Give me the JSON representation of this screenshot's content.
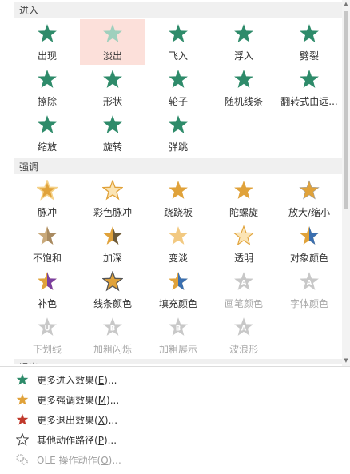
{
  "sections": {
    "entrance": "进入",
    "emphasis": "强调",
    "exit": "退出"
  },
  "entrance": [
    {
      "label": "出现",
      "icon": "appear-star-icon"
    },
    {
      "label": "淡出",
      "icon": "fade-star-icon"
    },
    {
      "label": "飞入",
      "icon": "fly-in-star-icon"
    },
    {
      "label": "浮入",
      "icon": "float-in-star-icon"
    },
    {
      "label": "劈裂",
      "icon": "split-star-icon"
    },
    {
      "label": "擦除",
      "icon": "wipe-star-icon"
    },
    {
      "label": "形状",
      "icon": "shape-star-icon"
    },
    {
      "label": "轮子",
      "icon": "wheel-star-icon"
    },
    {
      "label": "随机线条",
      "icon": "random-bars-star-icon"
    },
    {
      "label": "翻转式由远...",
      "icon": "grow-turn-star-icon"
    },
    {
      "label": "缩放",
      "icon": "zoom-star-icon"
    },
    {
      "label": "旋转",
      "icon": "swivel-star-icon"
    },
    {
      "label": "弹跳",
      "icon": "bounce-star-icon"
    }
  ],
  "emphasis": [
    {
      "label": "脉冲",
      "icon": "pulse-star-icon"
    },
    {
      "label": "彩色脉冲",
      "icon": "color-pulse-star-icon"
    },
    {
      "label": "跷跷板",
      "icon": "teeter-star-icon"
    },
    {
      "label": "陀螺旋",
      "icon": "spin-star-icon"
    },
    {
      "label": "放大/缩小",
      "icon": "grow-shrink-star-icon"
    },
    {
      "label": "不饱和",
      "icon": "desaturate-star-icon"
    },
    {
      "label": "加深",
      "icon": "darken-star-icon"
    },
    {
      "label": "变淡",
      "icon": "lighten-star-icon"
    },
    {
      "label": "透明",
      "icon": "transparency-star-icon"
    },
    {
      "label": "对象颜色",
      "icon": "object-color-star-icon"
    },
    {
      "label": "补色",
      "icon": "complementary-color-star-icon"
    },
    {
      "label": "线条颜色",
      "icon": "line-color-star-icon"
    },
    {
      "label": "填充颜色",
      "icon": "fill-color-star-icon"
    },
    {
      "label": "画笔颜色",
      "icon": "brush-color-star-icon",
      "disabled": true
    },
    {
      "label": "字体颜色",
      "icon": "font-color-star-icon",
      "disabled": true
    },
    {
      "label": "下划线",
      "icon": "underline-star-icon",
      "disabled": true
    },
    {
      "label": "加粗闪烁",
      "icon": "bold-flash-star-icon",
      "disabled": true
    },
    {
      "label": "加粗展示",
      "icon": "bold-reveal-star-icon",
      "disabled": true
    },
    {
      "label": "波浪形",
      "icon": "wave-star-icon",
      "disabled": true
    }
  ],
  "menu": [
    {
      "prefix": "更多进入效果(",
      "key": "E",
      "suffix": ")...",
      "icon": "green-star-icon"
    },
    {
      "prefix": "更多强调效果(",
      "key": "M",
      "suffix": ")...",
      "icon": "gold-star-icon"
    },
    {
      "prefix": "更多退出效果(",
      "key": "X",
      "suffix": ")...",
      "icon": "red-star-icon"
    },
    {
      "prefix": "其他动作路径(",
      "key": "P",
      "suffix": ")...",
      "icon": "outline-star-icon"
    },
    {
      "prefix": "OLE 操作动作(",
      "key": "O",
      "suffix": ")...",
      "icon": "gears-icon",
      "disabled": true
    }
  ],
  "colors": {
    "green": "#2e8b6a",
    "gold": "#e0a23a",
    "red": "#c0392b",
    "blue": "#3a6fb0",
    "purple": "#7b3fa0",
    "gray": "#c8c8c8",
    "selected_bg": "#fce0da"
  }
}
